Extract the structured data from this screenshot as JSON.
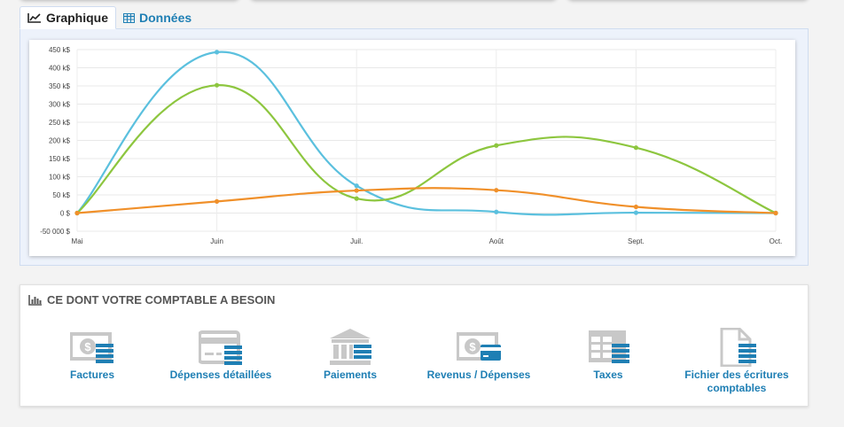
{
  "tabs": [
    {
      "label": "Graphique",
      "icon": "line-chart-icon",
      "active": true
    },
    {
      "label": "Données",
      "icon": "table-icon",
      "active": false
    }
  ],
  "chart_data": {
    "type": "line",
    "categories": [
      "Mai",
      "Juin",
      "Juil.",
      "Août",
      "Sept.",
      "Oct."
    ],
    "y_ticks": [
      "450 k$",
      "400 k$",
      "350 k$",
      "300 k$",
      "250 k$",
      "200 k$",
      "150 k$",
      "100 k$",
      "50 k$",
      "0 $",
      "-50 000 $"
    ],
    "ylim": [
      -50000,
      450000
    ],
    "grid": true,
    "series": [
      {
        "color": "#5bc0de",
        "values": [
          0,
          443000,
          75000,
          3000,
          1000,
          0
        ]
      },
      {
        "color": "#8dc63f",
        "values": [
          0,
          352000,
          40000,
          186000,
          180000,
          0
        ]
      },
      {
        "color": "#f0902a",
        "values": [
          0,
          32000,
          62000,
          63000,
          17000,
          0
        ]
      }
    ]
  },
  "accountant": {
    "title": "CE DONT VOTRE COMPTABLE A BESOIN",
    "items": [
      {
        "label": "Factures",
        "icon": "invoice-money-icon"
      },
      {
        "label": "Dépenses détaillées",
        "icon": "detailed-expenses-icon"
      },
      {
        "label": "Paiements",
        "icon": "bank-payments-icon"
      },
      {
        "label": "Revenus / Dépenses",
        "icon": "revenue-expenses-icon"
      },
      {
        "label": "Taxes",
        "icon": "taxes-table-icon"
      },
      {
        "label": "Fichier des écritures comptables",
        "icon": "accounting-file-icon"
      }
    ]
  },
  "colors": {
    "accent": "#1f7fb4",
    "icon_gray": "#c8c8c8",
    "icon_blue": "#1f7fb4"
  }
}
